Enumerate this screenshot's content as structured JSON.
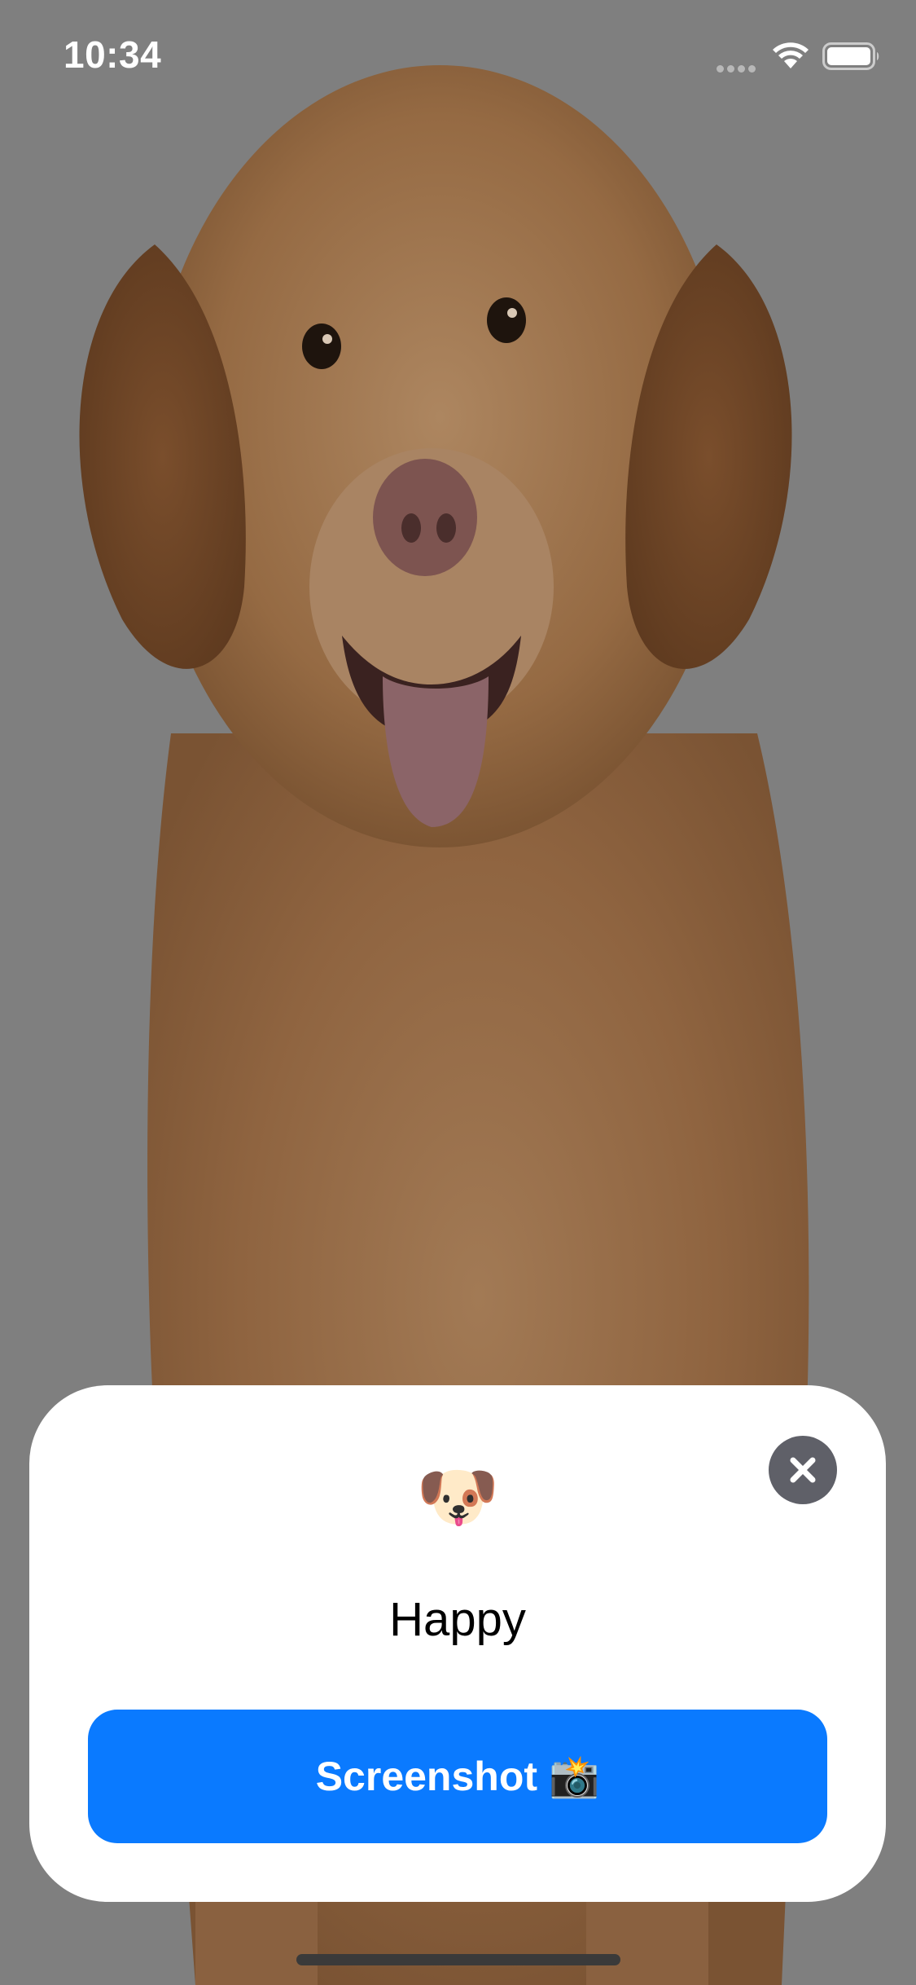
{
  "status_bar": {
    "time": "10:34",
    "wifi_icon": "wifi-icon",
    "battery_icon": "battery-full-icon",
    "signal_icon": "cellular-signal-icon"
  },
  "background": {
    "image": "golden-puppy-photo"
  },
  "card": {
    "emoji": "🐶",
    "mood": "Happy",
    "close_icon": "close-icon",
    "button_label": "Screenshot",
    "button_icon": "📸"
  },
  "colors": {
    "button_blue": "#0a7aff",
    "close_bg": "#5f6068",
    "card_bg": "#ffffff",
    "backdrop": "#7f7f7f"
  }
}
